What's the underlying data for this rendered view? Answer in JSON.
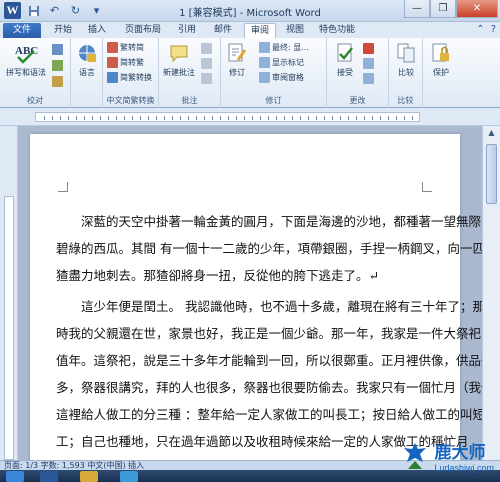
{
  "window": {
    "title": "1 [兼容模式] - Microsoft Word",
    "controls": [
      "—",
      "❐",
      "✕"
    ]
  },
  "tabs": [
    {
      "label": "文件"
    },
    {
      "label": "开始"
    },
    {
      "label": "插入"
    },
    {
      "label": "页面布局"
    },
    {
      "label": "引用"
    },
    {
      "label": "邮件"
    },
    {
      "label": "审阅"
    },
    {
      "label": "视图"
    },
    {
      "label": "特色功能"
    }
  ],
  "active_tab": "审阅",
  "ribbon": {
    "groups": {
      "proofing": {
        "label": "校对",
        "big": "拼写和语法",
        "small": [
          "",
          "",
          ""
        ]
      },
      "language": {
        "label": "",
        "big": "语言"
      },
      "chinese": {
        "label": "中文简繁转换",
        "items": [
          "繁转简",
          "简转繁",
          "简繁转换"
        ]
      },
      "comments": {
        "label": "批注",
        "big": "新建批注"
      },
      "tracking": {
        "label": "修订",
        "big": "修订",
        "items": [
          "最终: 显...",
          "显示标记",
          "审阅窗格"
        ]
      },
      "changes": {
        "label": "更改",
        "big": "接受"
      },
      "compare": {
        "label": "比较",
        "big": "比较"
      },
      "protect": {
        "label": "",
        "big": "保护"
      }
    }
  },
  "document": {
    "paragraphs": [
      "深藍的天空中掛著一輪金黃的圓月，下面是海邊的沙地，都種著一望無際的",
      "碧綠的西瓜。其間 有一個十一二歲的少年，項帶銀圈，手捏一柄鋼叉，向一匹",
      "猹盡力地刺去。那猹卻將身一扭，反從他的胯下逃走了。↵",
      "這少年便是閏土。 我認識他時，也不過十多歲，離現在將有三十年了；那",
      "時我的父親還在世，家景也好，我正是一個少爺。那一年，我家是一件大祭祀的",
      "值年。這祭祀，說是三十多年才能輪到一回，所以很鄭重。正月裡供像，供品很",
      "多，祭器很講究，拜的人也很多，祭器也很要防偷去。我家只有一個忙月（我們",
      "這裡給人做工的分三種 ：整年給一定人家做工的叫長工；按日給人做工的叫短",
      "工；自己也種地，只在過年過節以及收租時候來給一定的人家做工的稱忙月"
    ]
  },
  "statusbar": {
    "text": "页面: 1/3    字数: 1,593    中文(中国)    插入"
  },
  "watermark": {
    "cn": "鹿大师",
    "en": "Ludashiwj.com"
  }
}
